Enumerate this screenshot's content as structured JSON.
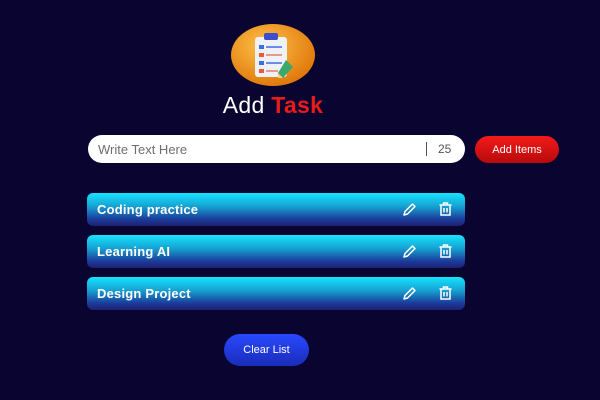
{
  "header": {
    "logo_icon": "clipboard-checklist-icon",
    "title_part1": "Add",
    "title_part2": "Task"
  },
  "input": {
    "placeholder": "Write Text Here",
    "value": "",
    "counter": "25"
  },
  "add_button_label": "Add Items",
  "tasks": [
    {
      "label": "Coding practice"
    },
    {
      "label": "Learning AI"
    },
    {
      "label": "Design Project"
    }
  ],
  "clear_button_label": "Clear List",
  "colors": {
    "background": "#0a0430",
    "accent_red": "#e81a1a",
    "task_cyan": "#17e3ff",
    "task_navy": "#1d2070",
    "clear_blue": "#2848ff"
  },
  "icons": {
    "edit": "pencil-icon",
    "delete": "trash-icon"
  }
}
